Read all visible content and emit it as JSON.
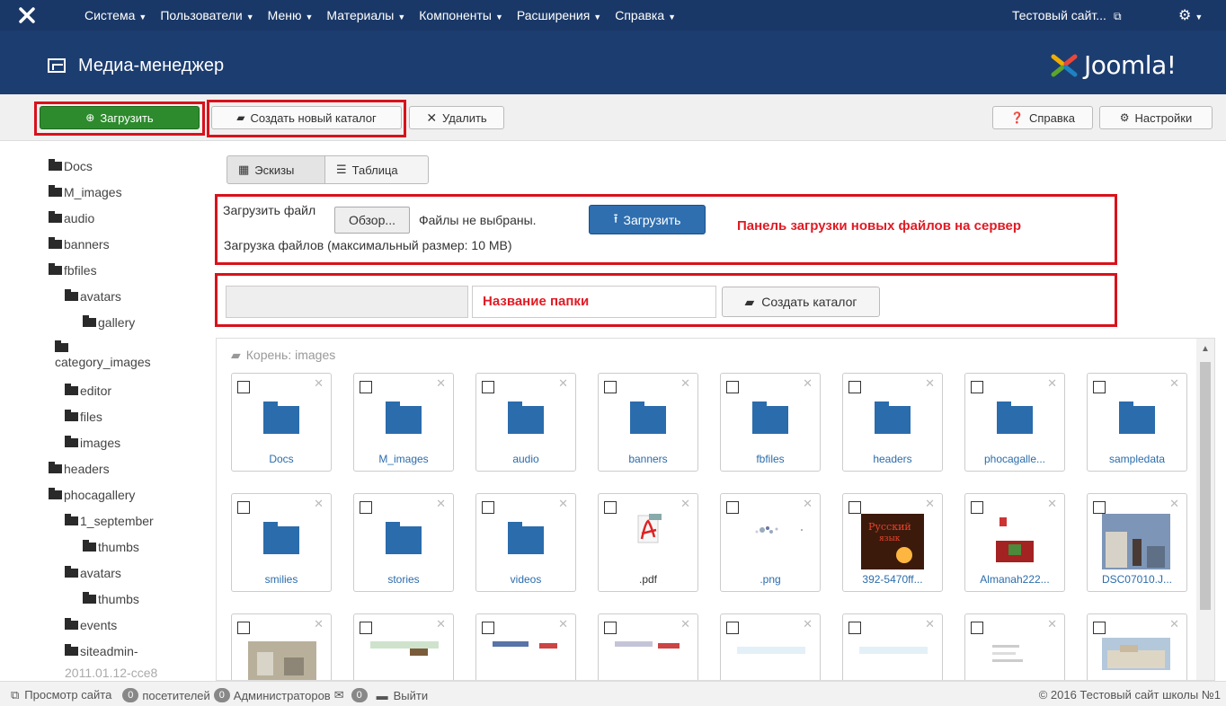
{
  "topbar": {
    "menu": [
      "Система",
      "Пользователи",
      "Меню",
      "Материалы",
      "Компоненты",
      "Расширения",
      "Справка"
    ],
    "site_link": "Тестовый сайт..."
  },
  "header": {
    "title": "Медиа-менеджер",
    "logo_text": "Joomla!"
  },
  "toolbar": {
    "upload": "Загрузить",
    "new_folder": "Создать новый каталог",
    "delete": "Удалить",
    "help": "Справка",
    "settings": "Настройки"
  },
  "tree": {
    "items": [
      "Docs",
      "M_images",
      "audio",
      "banners",
      "fbfiles",
      "avatars",
      "gallery",
      "category_images",
      "editor",
      "files",
      "images",
      "headers",
      "phocagallery",
      "1_september",
      "thumbs",
      "avatars",
      "thumbs",
      "events",
      "siteadmin-",
      "2011.01.12-cce8"
    ]
  },
  "view": {
    "thumbs": "Эскизы",
    "table": "Таблица"
  },
  "upload_panel": {
    "label": "Загрузить файл",
    "browse": "Обзор...",
    "no_files": "Файлы не выбраны.",
    "upload_btn": "Загрузить",
    "max_size": "Загрузка файлов (максимальный размер: 10 MB)",
    "annotation": "Панель загрузки новых файлов на сервер"
  },
  "folder_panel": {
    "name_label": "Название папки",
    "create_btn": "Создать каталог"
  },
  "browser": {
    "crumb": "Корень: images",
    "row1": [
      "Docs",
      "M_images",
      "audio",
      "banners",
      "fbfiles",
      "headers",
      "phocagalle...",
      "sampledata"
    ],
    "row2": [
      "smilies",
      "stories",
      "videos",
      ".pdf",
      ".png",
      "392-5470ff...",
      "Almanah222...",
      "DSC07010.J..."
    ]
  },
  "footer": {
    "view_site": "Просмотр сайта",
    "visitors_count": "0",
    "visitors": "посетителей",
    "admins_count": "0",
    "admins": "Администраторов",
    "messages_count": "0",
    "logout": "Выйти",
    "copyright": "© 2016 Тестовый сайт школы №1"
  },
  "colors": {
    "nav": "#1a3867",
    "header": "#1c3d70",
    "accent_green": "#2d8b2d",
    "accent_blue": "#2f6fb0",
    "annotation_red": "#d8121b"
  }
}
